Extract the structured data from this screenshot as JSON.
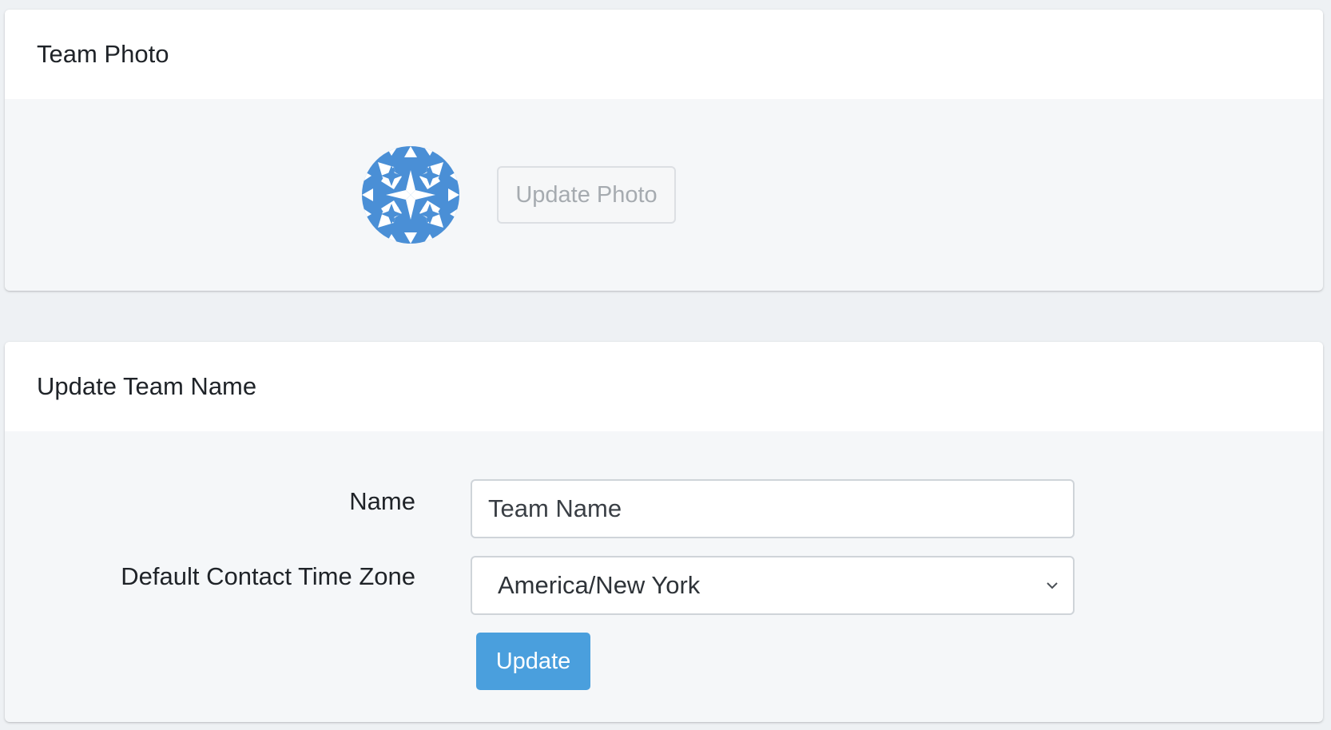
{
  "team_photo_card": {
    "title": "Team Photo",
    "avatar_icon": "geometric-star-pattern",
    "avatar_color": "#4a8fd6",
    "update_photo_label": "Update Photo"
  },
  "team_name_card": {
    "title": "Update Team Name",
    "name_label": "Name",
    "name_placeholder": "Team Name",
    "name_value": "",
    "timezone_label": "Default Contact Time Zone",
    "timezone_value": "America/New York",
    "timezone_icon": "chevron-down-icon",
    "update_button_label": "Update",
    "accent_color": "#4a9fdd"
  }
}
